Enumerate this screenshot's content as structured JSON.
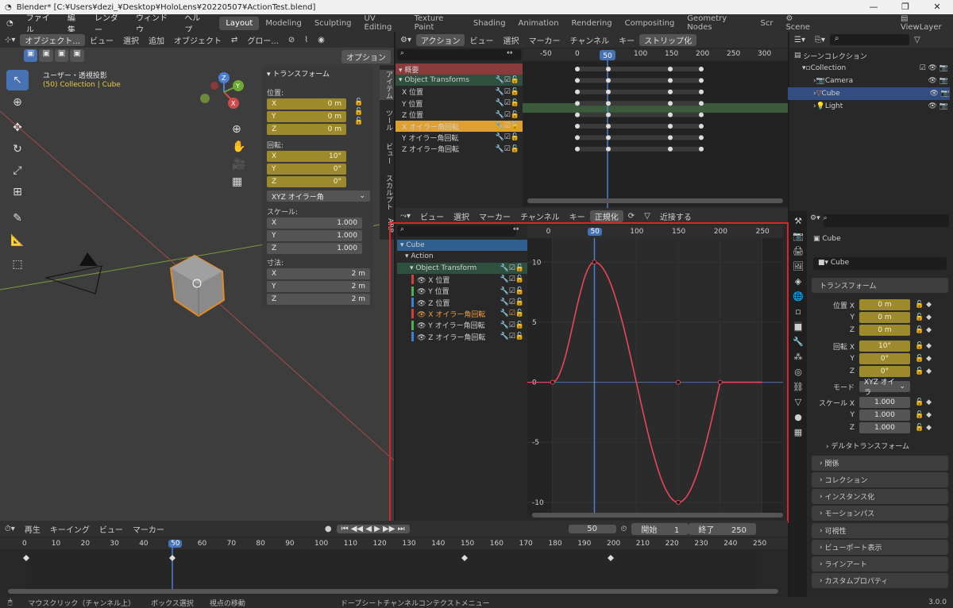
{
  "window": {
    "title": "Blender* [C:¥Users¥dezi_¥Desktop¥HoloLens¥20220507¥ActionTest.blend]",
    "minimize": "—",
    "maximize": "❐",
    "close": "✕"
  },
  "menu": [
    "ファイル",
    "編集",
    "レンダー",
    "ウィンドウ",
    "ヘルプ"
  ],
  "workspaces": [
    "Layout",
    "Modeling",
    "Sculpting",
    "UV Editing",
    "Texture Paint",
    "Shading",
    "Animation",
    "Rendering",
    "Compositing",
    "Geometry Nodes",
    "Scr"
  ],
  "active_workspace": "Layout",
  "scene": {
    "name": "Scene",
    "view_layer": "ViewLayer"
  },
  "viewport": {
    "header": {
      "mode": "オブジェクト...",
      "view": "ビュー",
      "select": "選択",
      "add": "追加",
      "object": "オブジェクト",
      "orientation": "グロー...",
      "options": "オプション"
    },
    "overlay_title": "ユーザー・透視投影",
    "overlay_sub": "(50) Collection | Cube",
    "gizmo": {
      "x": "X",
      "y": "Y",
      "z": "Z"
    }
  },
  "transform_panel": {
    "title": "トランスフォーム",
    "location_label": "位置:",
    "location": [
      {
        "axis": "X",
        "value": "0 m"
      },
      {
        "axis": "Y",
        "value": "0 m"
      },
      {
        "axis": "Z",
        "value": "0 m"
      }
    ],
    "rotation_label": "回転:",
    "rotation": [
      {
        "axis": "X",
        "value": "10°"
      },
      {
        "axis": "Y",
        "value": "0°"
      },
      {
        "axis": "Z",
        "value": "0°"
      }
    ],
    "rotation_mode": "XYZ オイラー角",
    "scale_label": "スケール:",
    "scale": [
      {
        "axis": "X",
        "value": "1.000"
      },
      {
        "axis": "Y",
        "value": "1.000"
      },
      {
        "axis": "Z",
        "value": "1.000"
      }
    ],
    "dimensions_label": "寸法:",
    "dimensions": [
      {
        "axis": "X",
        "value": "2 m"
      },
      {
        "axis": "Y",
        "value": "2 m"
      },
      {
        "axis": "Z",
        "value": "2 m"
      }
    ]
  },
  "sidebar_tabs": [
    "アイテム",
    "ツール",
    "ビュー",
    "スカルプト",
    "ARP"
  ],
  "dopesheet": {
    "header": {
      "mode": "アクション",
      "view": "ビュー",
      "select": "選択",
      "marker": "マーカー",
      "channel": "チャンネル",
      "key": "キー",
      "stash": "ストリップ化"
    },
    "ruler": [
      "-50",
      "0",
      "50",
      "100",
      "150",
      "200",
      "250",
      "300"
    ],
    "current_frame": "50",
    "channels": [
      {
        "name": "概要",
        "color": "#8a3b3b"
      },
      {
        "name": "Object Transforms",
        "color": "#2f4f3f"
      },
      {
        "name": "X 位置",
        "color": ""
      },
      {
        "name": "Y 位置",
        "color": ""
      },
      {
        "name": "Z 位置",
        "color": ""
      },
      {
        "name": "X オイラー角回転",
        "color": "#e0a030"
      },
      {
        "name": "Y オイラー角回転",
        "color": ""
      },
      {
        "name": "Z オイラー角回転",
        "color": ""
      }
    ]
  },
  "graph_editor": {
    "header": {
      "view": "ビュー",
      "select": "選択",
      "marker": "マーカー",
      "channel": "チャンネル",
      "key": "キー",
      "normalize": "正規化",
      "snap": "近接する"
    },
    "ruler": [
      "0",
      "50",
      "100",
      "150",
      "200",
      "250"
    ],
    "current_frame": "50",
    "channels": [
      {
        "name": "Cube",
        "color": "#2f5f8f"
      },
      {
        "name": "Action",
        "color": ""
      },
      {
        "name": "Object Transform",
        "color": "#2f4f3f"
      },
      {
        "name": "X 位置",
        "color": "#d04040"
      },
      {
        "name": "Y 位置",
        "color": "#50b050"
      },
      {
        "name": "Z 位置",
        "color": "#4080d0"
      },
      {
        "name": "X オイラー角回転",
        "color": "#d04040"
      },
      {
        "name": "Y オイラー角回転",
        "color": "#50b050"
      },
      {
        "name": "Z オイラー角回転",
        "color": "#4080d0"
      }
    ]
  },
  "chart_data": {
    "type": "line",
    "title": "",
    "xlabel": "",
    "ylabel": "",
    "x": [
      0,
      25,
      50,
      75,
      100,
      125,
      150,
      175,
      200,
      225,
      250
    ],
    "series": [
      {
        "name": "X オイラー角回転",
        "values": [
          0,
          6,
          10,
          6,
          0,
          -6,
          -10,
          -6,
          0,
          0,
          0
        ]
      }
    ],
    "yticks": [
      10,
      5,
      0,
      -5,
      -10
    ],
    "ylim": [
      -11,
      12
    ],
    "xlim": [
      -30,
      275
    ],
    "keyframes": [
      {
        "x": 0,
        "y": 0
      },
      {
        "x": 50,
        "y": 10
      },
      {
        "x": 150,
        "y": 0
      },
      {
        "x": 150,
        "y": -10
      },
      {
        "x": 200,
        "y": 0
      }
    ]
  },
  "timeline": {
    "header": {
      "playback": "再生",
      "keying": "キーイング",
      "view": "ビュー",
      "marker": "マーカー"
    },
    "current": "50",
    "start_label": "開始",
    "start": "1",
    "end_label": "終了",
    "end": "250",
    "ruler": [
      "0",
      "10",
      "20",
      "30",
      "40",
      "50",
      "60",
      "70",
      "80",
      "90",
      "100",
      "110",
      "120",
      "130",
      "140",
      "150",
      "160",
      "170",
      "180",
      "190",
      "200",
      "210",
      "220",
      "230",
      "240",
      "250"
    ]
  },
  "outliner": {
    "scene_collection": "シーンコレクション",
    "items": [
      {
        "name": "Collection",
        "depth": 1
      },
      {
        "name": "Camera",
        "depth": 2
      },
      {
        "name": "Cube",
        "depth": 2
      },
      {
        "name": "Light",
        "depth": 2
      }
    ]
  },
  "properties": {
    "object_name": "Cube",
    "data_name": "Cube",
    "section_transform": "トランスフォーム",
    "location_x_label": "位置 X",
    "location": [
      "0 m",
      "0 m",
      "0 m"
    ],
    "rotation_x_label": "回転 X",
    "rotation": [
      "10°",
      "0°",
      "0°"
    ],
    "mode_label": "モード",
    "mode_value": "XYZ オイラ",
    "scale_x_label": "スケール X",
    "scale": [
      "1.000",
      "1.000",
      "1.000"
    ],
    "axis_y": "Y",
    "axis_z": "Z",
    "sections": [
      "デルタトランスフォーム",
      "関係",
      "コレクション",
      "インスタンス化",
      "モーションパス",
      "可視性",
      "ビューポート表示",
      "ラインアート",
      "カスタムプロパティ"
    ]
  },
  "status_bar": {
    "left": "マウスクリック（チャンネル上）",
    "mid": "ボックス選択",
    "mid2": "視点の移動",
    "right": "ドープシートチャンネルコンテクストメニュー",
    "version": "3.0.0"
  }
}
